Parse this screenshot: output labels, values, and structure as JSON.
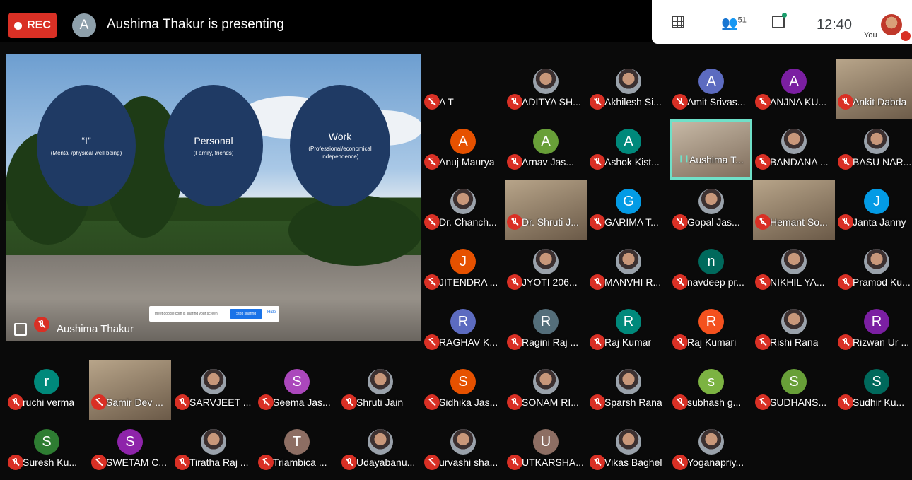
{
  "topbar": {
    "rec_label": "REC",
    "presenter_initial": "A",
    "presenting_text": "Aushima Thakur is presenting"
  },
  "controls": {
    "participant_count": "51",
    "time": "12:40",
    "you_label": "You"
  },
  "stage": {
    "presenter_name": "Aushima Thakur",
    "slide": {
      "circles": [
        {
          "title": "“I”",
          "subtitle": "(Mental /physical well being)"
        },
        {
          "title": "Personal",
          "subtitle": "(Family, friends)"
        },
        {
          "title": "Work",
          "subtitle": "(Professional/economical independence)"
        }
      ],
      "share_notice": "meet.google.com is sharing your screen.",
      "stop_sharing": "Stop sharing",
      "hide": "Hide"
    }
  },
  "colors": {
    "red": "#d93025",
    "slide_circle": "#1f3a64",
    "speaking_border": "#6fe0c8"
  },
  "participants": [
    {
      "name": "A T",
      "type": "none"
    },
    {
      "name": "ADITYA SH...",
      "type": "photo"
    },
    {
      "name": "Akhilesh Si...",
      "type": "photo"
    },
    {
      "name": "Amit Srivas...",
      "type": "initial",
      "initial": "A",
      "color": "#5c6bc0"
    },
    {
      "name": "ANJNA KU...",
      "type": "initial",
      "initial": "A",
      "color": "#7b1fa2"
    },
    {
      "name": "Ankit Dabda",
      "type": "video"
    },
    {
      "name": "Anuj Maurya",
      "type": "initial",
      "initial": "A",
      "color": "#e65100"
    },
    {
      "name": "Arnav Jas...",
      "type": "initial",
      "initial": "A",
      "color": "#689f38"
    },
    {
      "name": "Ashok Kist...",
      "type": "initial",
      "initial": "A",
      "color": "#00897b"
    },
    {
      "name": "Aushima T...",
      "type": "speaking"
    },
    {
      "name": "BANDANA ...",
      "type": "photo"
    },
    {
      "name": "BASU NAR...",
      "type": "photo"
    },
    {
      "name": "Dr. Chanch...",
      "type": "photo"
    },
    {
      "name": "Dr. Shruti J...",
      "type": "video"
    },
    {
      "name": "GARIMA T...",
      "type": "initial",
      "initial": "G",
      "color": "#039be5"
    },
    {
      "name": "Gopal Jas...",
      "type": "photo"
    },
    {
      "name": "Hemant So...",
      "type": "video"
    },
    {
      "name": "Janta Janny",
      "type": "initial",
      "initial": "J",
      "color": "#039be5"
    },
    {
      "name": "JITENDRA ...",
      "type": "initial",
      "initial": "J",
      "color": "#e65100"
    },
    {
      "name": "JYOTI 206...",
      "type": "photo"
    },
    {
      "name": "MANVHI R...",
      "type": "photo"
    },
    {
      "name": "navdeep pr...",
      "type": "initial",
      "initial": "n",
      "color": "#00695c"
    },
    {
      "name": "NIKHIL YA...",
      "type": "photo"
    },
    {
      "name": "Pramod Ku...",
      "type": "photo"
    },
    {
      "name": "RAGHAV K...",
      "type": "initial",
      "initial": "R",
      "color": "#5c6bc0"
    },
    {
      "name": "Ragini Raj ...",
      "type": "initial",
      "initial": "R",
      "color": "#546e7a"
    },
    {
      "name": "Raj Kumar",
      "type": "initial",
      "initial": "R",
      "color": "#00897b"
    },
    {
      "name": "Raj Kumari",
      "type": "initial",
      "initial": "R",
      "color": "#f4511e"
    },
    {
      "name": "Rishi Rana",
      "type": "photo"
    },
    {
      "name": "Rizwan Ur ...",
      "type": "initial",
      "initial": "R",
      "color": "#7b1fa2"
    },
    {
      "name": "ruchi verma",
      "type": "initial",
      "initial": "r",
      "color": "#00897b"
    },
    {
      "name": "Samir Dev ...",
      "type": "video"
    },
    {
      "name": "SARVJEET ...",
      "type": "photo"
    },
    {
      "name": "Seema Jas...",
      "type": "initial",
      "initial": "S",
      "color": "#ab47bc"
    },
    {
      "name": "Shruti Jain",
      "type": "photo"
    },
    {
      "name": "Sidhika Jas...",
      "type": "initial",
      "initial": "S",
      "color": "#e65100"
    },
    {
      "name": "SONAM RI...",
      "type": "photo"
    },
    {
      "name": "Sparsh Rana",
      "type": "photo"
    },
    {
      "name": "subhash g...",
      "type": "initial",
      "initial": "s",
      "color": "#7cb342"
    },
    {
      "name": "SUDHANS...",
      "type": "initial",
      "initial": "S",
      "color": "#689f38"
    },
    {
      "name": "Sudhir Ku...",
      "type": "initial",
      "initial": "S",
      "color": "#00695c"
    },
    {
      "name": "Suresh Ku...",
      "type": "initial",
      "initial": "S",
      "color": "#2e7d32"
    },
    {
      "name": "SWETAM C...",
      "type": "initial",
      "initial": "S",
      "color": "#8e24aa"
    },
    {
      "name": "Tiratha Raj ...",
      "type": "photo"
    },
    {
      "name": "Triambica ...",
      "type": "initial",
      "initial": "T",
      "color": "#8d6e63"
    },
    {
      "name": "Udayabanu...",
      "type": "photo"
    },
    {
      "name": "urvashi sha...",
      "type": "photo"
    },
    {
      "name": "UTKARSHA...",
      "type": "initial",
      "initial": "U",
      "color": "#8d6e63"
    },
    {
      "name": "Vikas Baghel",
      "type": "photo"
    },
    {
      "name": "Yoganapriy...",
      "type": "photo"
    }
  ]
}
